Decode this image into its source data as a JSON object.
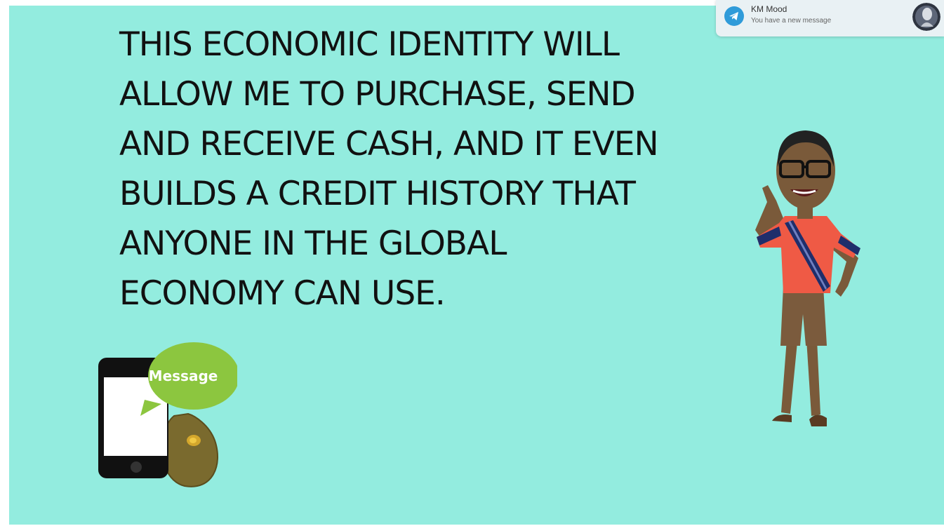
{
  "slide": {
    "background": "#93ecdf",
    "caption_lines": [
      "THIS ECONOMIC IDENTITY WILL",
      "ALLOW ME TO PURCHASE, SEND",
      "AND RECEIVE CASH, AND IT EVEN",
      "BUILDS A CREDIT HISTORY THAT",
      "ANYONE IN THE GLOBAL",
      "ECONOMY CAN USE."
    ],
    "illustration": {
      "bubble_text": "Message",
      "bubble_color": "#8cc63f"
    }
  },
  "notification": {
    "app_icon": "telegram-icon",
    "sender": "KM Mood",
    "message": "You have a new message",
    "accent": "#2f9bd9"
  }
}
